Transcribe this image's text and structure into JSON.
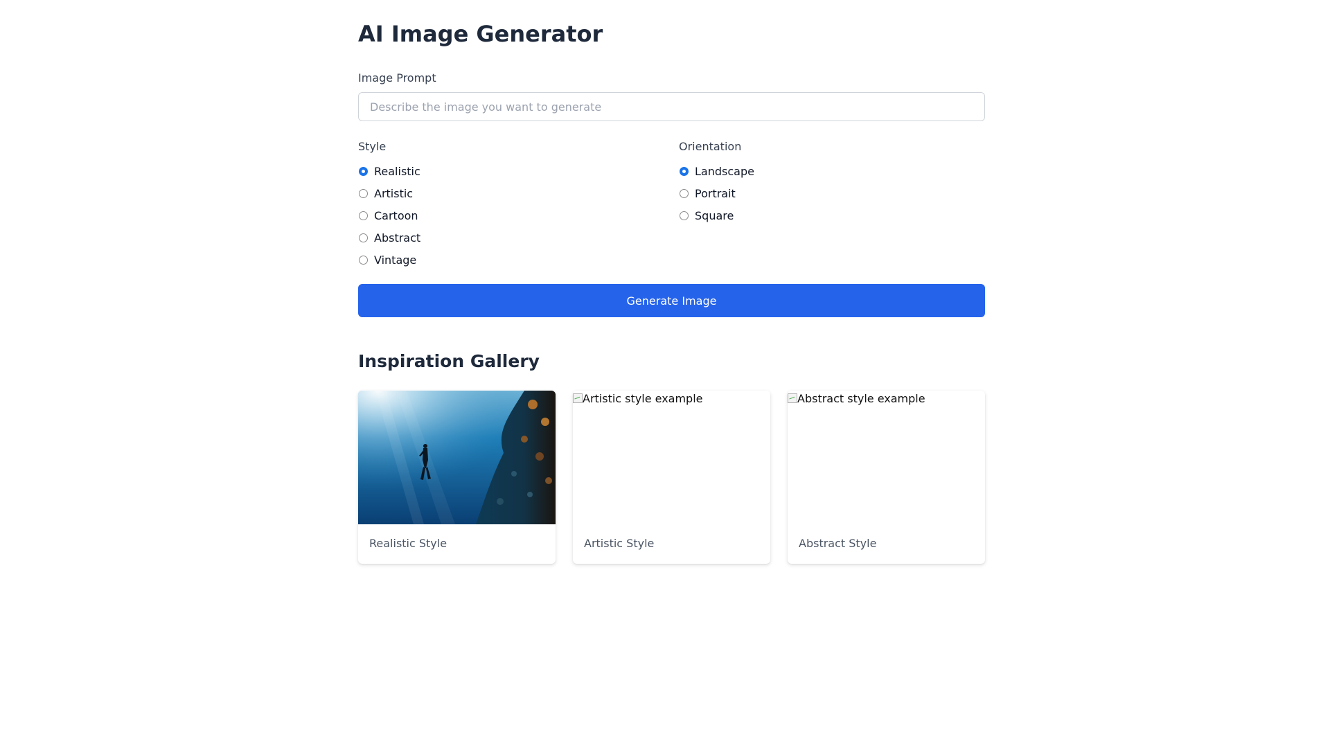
{
  "header": {
    "title": "AI Image Generator"
  },
  "prompt": {
    "label": "Image Prompt",
    "value": "",
    "placeholder": "Describe the image you want to generate"
  },
  "style": {
    "label": "Style",
    "options": [
      {
        "label": "Realistic",
        "checked": true
      },
      {
        "label": "Artistic",
        "checked": false
      },
      {
        "label": "Cartoon",
        "checked": false
      },
      {
        "label": "Abstract",
        "checked": false
      },
      {
        "label": "Vintage",
        "checked": false
      }
    ]
  },
  "orientation": {
    "label": "Orientation",
    "options": [
      {
        "label": "Landscape",
        "checked": true
      },
      {
        "label": "Portrait",
        "checked": false
      },
      {
        "label": "Square",
        "checked": false
      }
    ]
  },
  "generate_button": {
    "label": "Generate Image",
    "color": "#2563eb"
  },
  "gallery": {
    "title": "Inspiration Gallery",
    "cards": [
      {
        "caption": "Realistic Style",
        "image_alt": "",
        "image_broken": false
      },
      {
        "caption": "Artistic Style",
        "image_alt": "Artistic style example",
        "image_broken": true
      },
      {
        "caption": "Abstract Style",
        "image_alt": "Abstract style example",
        "image_broken": true
      }
    ]
  },
  "colors": {
    "accent": "#2563eb",
    "radio_checked": "#1a73e8",
    "heading": "#1e293b"
  }
}
